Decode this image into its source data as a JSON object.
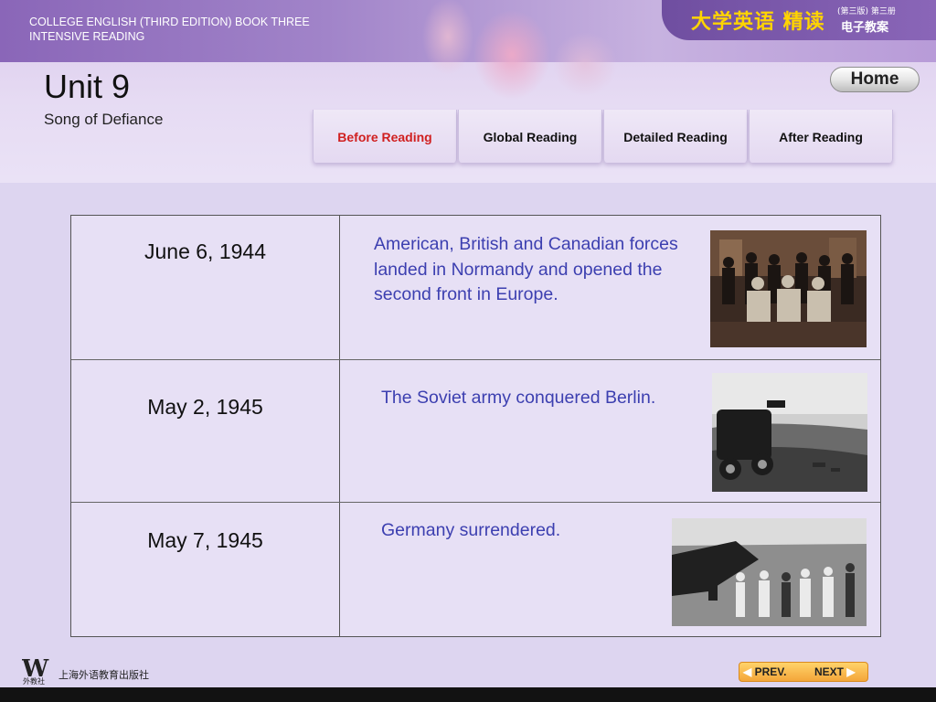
{
  "header": {
    "series_line1": "COLLEGE ENGLISH (THIRD EDITION) BOOK THREE",
    "series_line2": "INTENSIVE READING",
    "brand_main": "大学英语 精读",
    "brand_sub1": "(第三版) 第三册",
    "brand_sub2": "电子教案",
    "unit_title": "Unit 9",
    "unit_subtitle": "Song of Defiance",
    "home_label": "Home"
  },
  "tabs": [
    {
      "label": "Before Reading",
      "active": true
    },
    {
      "label": "Global Reading",
      "active": false
    },
    {
      "label": "Detailed Reading",
      "active": false
    },
    {
      "label": "After Reading",
      "active": false
    }
  ],
  "timeline": [
    {
      "date": "June 6, 1944",
      "event": "American, British and Canadian forces landed in Normandy and opened the second front in Europe.",
      "photo_icon": "photo-conference-icon"
    },
    {
      "date": "May 2, 1945",
      "event": "The Soviet army conquered Berlin.",
      "photo_icon": "photo-battlefield-icon"
    },
    {
      "date": "May 7, 1945",
      "event": "Germany surrendered.",
      "photo_icon": "photo-wreckage-icon"
    }
  ],
  "footer": {
    "publisher_logo": "W",
    "publisher_logo_sub": "外教社",
    "publisher_name": "上海外语教育出版社",
    "prev_label": "PREV.",
    "next_label": "NEXT"
  },
  "colors": {
    "accent_purple": "#8a66b8",
    "brand_yellow": "#ffd400",
    "active_tab": "#d02020",
    "event_text": "#3c3fb0"
  }
}
